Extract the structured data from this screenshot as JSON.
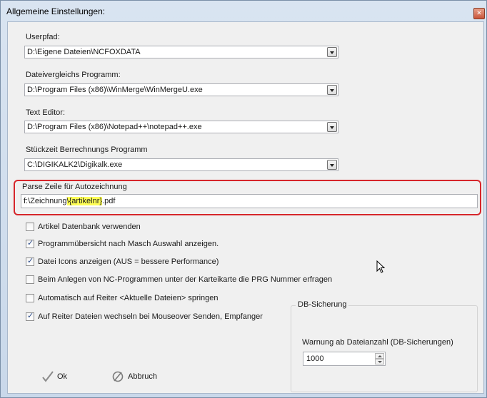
{
  "window": {
    "title": "Allgemeine Einstellungen:"
  },
  "fields": {
    "userpfad": {
      "label": "Userpfad:",
      "value": "D:\\Eigene Dateien\\NCFOXDATA"
    },
    "diff": {
      "label": "Dateivergleichs Programm:",
      "value": "D:\\Program Files (x86)\\WinMerge\\WinMergeU.exe"
    },
    "editor": {
      "label": "Text Editor:",
      "value": "D:\\Program Files (x86)\\Notepad++\\notepad++.exe"
    },
    "stueckzeit": {
      "label": "Stückzeit Berrechnungs Programm",
      "value": "C:\\DIGIKALK2\\Digikalk.exe"
    },
    "parse": {
      "label": "Parse Zeile für Autozeichnung",
      "value_prefix": "f:\\Zeichnung",
      "value_highlight": "\\{artikelnr}",
      "value_suffix": ".pdf"
    }
  },
  "checkboxes": [
    {
      "label": "Artikel Datenbank verwenden",
      "checked": false
    },
    {
      "label": "Programmübersicht nach Masch Auswahl anzeigen.",
      "checked": true
    },
    {
      "label": "Datei Icons anzeigen (AUS = bessere Performance)",
      "checked": true
    },
    {
      "label": "Beim Anlegen von NC-Programmen unter der Karteikarte die PRG Nummer erfragen",
      "checked": false
    },
    {
      "label": "Automatisch auf Reiter <Aktuelle Dateien> springen",
      "checked": false
    },
    {
      "label": "Auf Reiter Dateien wechseln bei Mouseover Senden, Empfanger",
      "checked": true
    }
  ],
  "db": {
    "group_title": "DB-Sicherung",
    "warn_label": "Warnung ab Dateianzahl (DB-Sicherungen)",
    "warn_value": "1000"
  },
  "buttons": {
    "ok": "Ok",
    "cancel": "Abbruch"
  },
  "colors": {
    "highlight": "#ffff55",
    "annotation": "#d6262b",
    "check": "#2a4a8a"
  }
}
